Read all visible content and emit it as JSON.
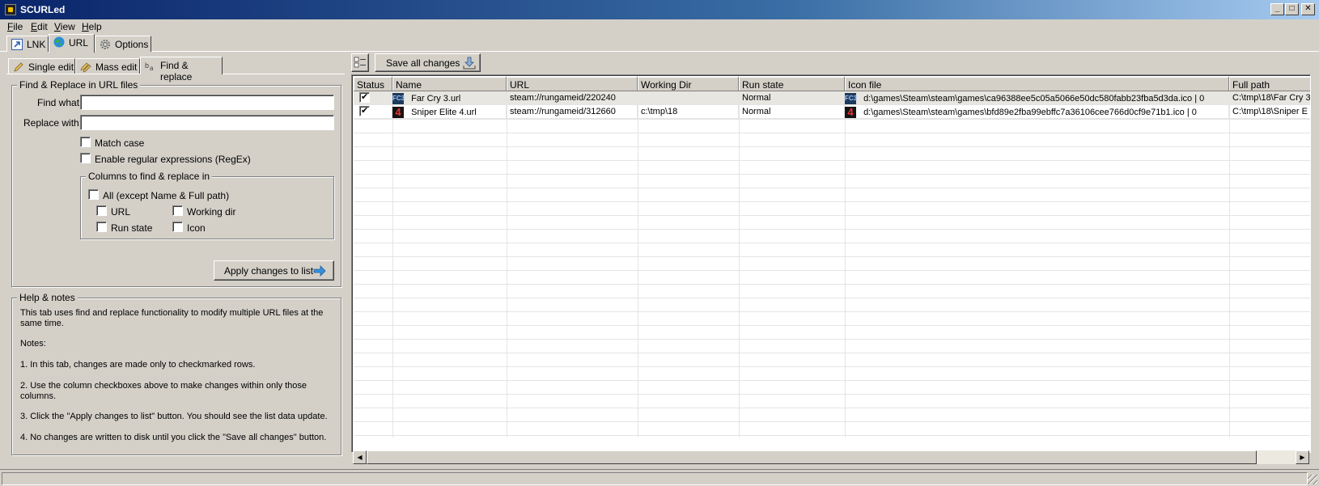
{
  "window": {
    "title": "SCURLed"
  },
  "menu": [
    "File",
    "Edit",
    "View",
    "Help"
  ],
  "top_tabs": [
    {
      "label": "LNK",
      "icon": "shortcut-arrow-icon"
    },
    {
      "label": "URL",
      "icon": "globe-icon"
    },
    {
      "label": "Options",
      "icon": "gear-icon"
    }
  ],
  "sub_tabs": [
    {
      "label": "Single edit",
      "icon": "pencil-icon"
    },
    {
      "label": "Mass edit",
      "icon": "stack-pencil-icon"
    },
    {
      "label": "Find & replace",
      "icon": "find-replace-icon"
    }
  ],
  "find_replace": {
    "group_title": "Find & Replace in URL files",
    "find_label": "Find what:",
    "find_value": "",
    "replace_label": "Replace with:",
    "replace_value": "",
    "match_case": "Match case",
    "regex": "Enable regular expressions (RegEx)",
    "columns_group": "Columns to find & replace in",
    "all_label": "All (except Name & Full path)",
    "col_url": "URL",
    "col_working_dir": "Working dir",
    "col_run_state": "Run state",
    "col_icon": "Icon",
    "apply_button": "Apply changes to list"
  },
  "help": {
    "title": "Help & notes",
    "intro": "This tab uses find and replace functionality to modify multiple URL files at the same time.",
    "notes_label": "Notes:",
    "note1": "1. In this tab, changes are made only to checkmarked rows.",
    "note2": "2. Use the column checkboxes above to make changes within only those columns.",
    "note3": "3. Click the \"Apply changes to list\" button.  You should see the list data update.",
    "note4": "4. No changes are written to disk until you click the \"Save all changes\" button."
  },
  "toolbar": {
    "save_all": "Save all changes"
  },
  "grid": {
    "columns": [
      "Status",
      "Name",
      "URL",
      "Working Dir",
      "Run state",
      "Icon file",
      "Full path"
    ],
    "rows": [
      {
        "checked": true,
        "icon_text": "FC3",
        "name": "Far Cry 3.url",
        "url": "steam://rungameid/220240",
        "working_dir": "",
        "run_state": "Normal",
        "icon_file": "d:\\games\\Steam\\steam\\games\\ca96388ee5c05a5066e50dc580fabb23fba5d3da.ico | 0",
        "full_path": "C:\\tmp\\18\\Far Cry 3"
      },
      {
        "checked": true,
        "icon_text": "4",
        "name": "Sniper Elite 4.url",
        "url": "steam://rungameid/312660",
        "working_dir": "c:\\tmp\\18",
        "run_state": "Normal",
        "icon_file": "d:\\games\\Steam\\steam\\games\\bfd89e2fba99ebffc7a36106cee766d0cf9e71b1.ico | 0",
        "full_path": "C:\\tmp\\18\\Sniper E"
      }
    ]
  }
}
